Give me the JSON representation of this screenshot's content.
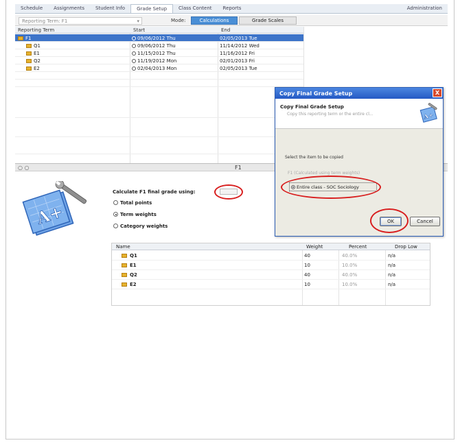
{
  "tabs": [
    {
      "label": "Schedule"
    },
    {
      "label": "Assignments"
    },
    {
      "label": "Student Info"
    },
    {
      "label": "Grade Setup"
    },
    {
      "label": "Class Content"
    },
    {
      "label": "Reports"
    }
  ],
  "tab_right": "Administration",
  "toolbar": {
    "reporting_term": "Reporting Term: F1",
    "mode_label": "Mode:",
    "calculations_label": "Calculations",
    "grade_scales_label": "Grade Scales"
  },
  "term_table": {
    "headers": {
      "name": "Reporting Term",
      "start": "Start",
      "end": "End"
    },
    "rows": [
      {
        "name": "F1",
        "start": "09/06/2012 Thu",
        "end": "02/05/2013 Tue"
      },
      {
        "name": "Q1",
        "start": "09/06/2012 Thu",
        "end": "11/14/2012 Wed"
      },
      {
        "name": "E1",
        "start": "11/15/2012 Thu",
        "end": "11/16/2012 Fri"
      },
      {
        "name": "Q2",
        "start": "11/19/2012 Mon",
        "end": "02/01/2013 Fri"
      },
      {
        "name": "E2",
        "start": "02/04/2013 Mon",
        "end": "02/05/2013 Tue"
      }
    ]
  },
  "section": {
    "nav": "○ ○",
    "title": "F1"
  },
  "calc": {
    "label": "Calculate F1 final grade using:",
    "options": [
      "Total points",
      "Term weights",
      "Category weights"
    ]
  },
  "weights_table": {
    "headers": {
      "name": "Name",
      "weight": "Weight",
      "percent": "Percent",
      "drop": "Drop Low"
    },
    "rows": [
      {
        "name": "Q1",
        "weight": "40",
        "percent": "40.0%",
        "drop": "n/a"
      },
      {
        "name": "E1",
        "weight": "10",
        "percent": "10.0%",
        "drop": "n/a"
      },
      {
        "name": "Q2",
        "weight": "40",
        "percent": "40.0%",
        "drop": "n/a"
      },
      {
        "name": "E2",
        "weight": "10",
        "percent": "10.0%",
        "drop": "n/a"
      }
    ]
  },
  "dialog": {
    "title": "Copy Final Grade Setup",
    "close": "X",
    "header_title": "Copy Final Grade Setup",
    "header_sub": "Copy this reporting term or the entire cl...",
    "prompt": "Select the item to be copied",
    "option1": "F1 (Calculated using term weights)",
    "option2": "Entire class - SOC Sociology",
    "ok": "OK",
    "cancel": "Cancel"
  },
  "colors": {
    "accent": "#3d74c9",
    "annotation": "#d81e1e",
    "dialog_title": "#2459c4"
  }
}
